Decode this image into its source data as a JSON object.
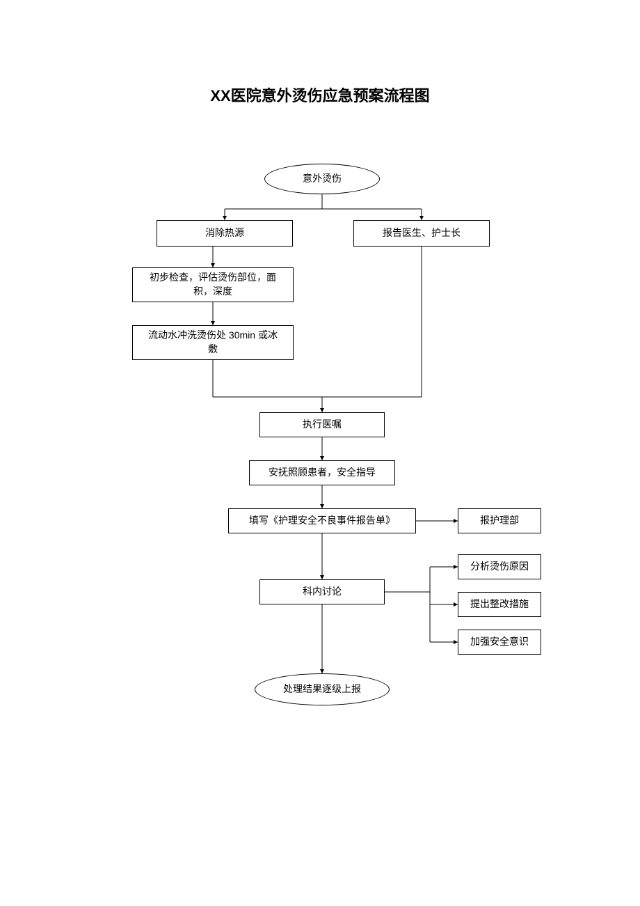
{
  "title_xx": "XX",
  "title_rest": "医院意外烫伤应急预案流程图",
  "n_start": "意外烫伤",
  "n_remove": "消除热源",
  "n_report_doc": "报告医生、护士长",
  "n_assess": "初步检查，评估烫伤部位，面\n积，深度",
  "n_rinse": "流动水冲洗烫伤处 30min 或冰\n敷",
  "n_exec": "执行医嘱",
  "n_comfort": "安抚照顾患者，安全指导",
  "n_form": "填写《护理安全不良事件报告单》",
  "n_nursing_dept": "报护理部",
  "n_discuss": "科内讨论",
  "n_out1": "分析烫伤原因",
  "n_out2": "提出整改措施",
  "n_out3": "加强安全意识",
  "n_end": "处理结果逐级上报"
}
